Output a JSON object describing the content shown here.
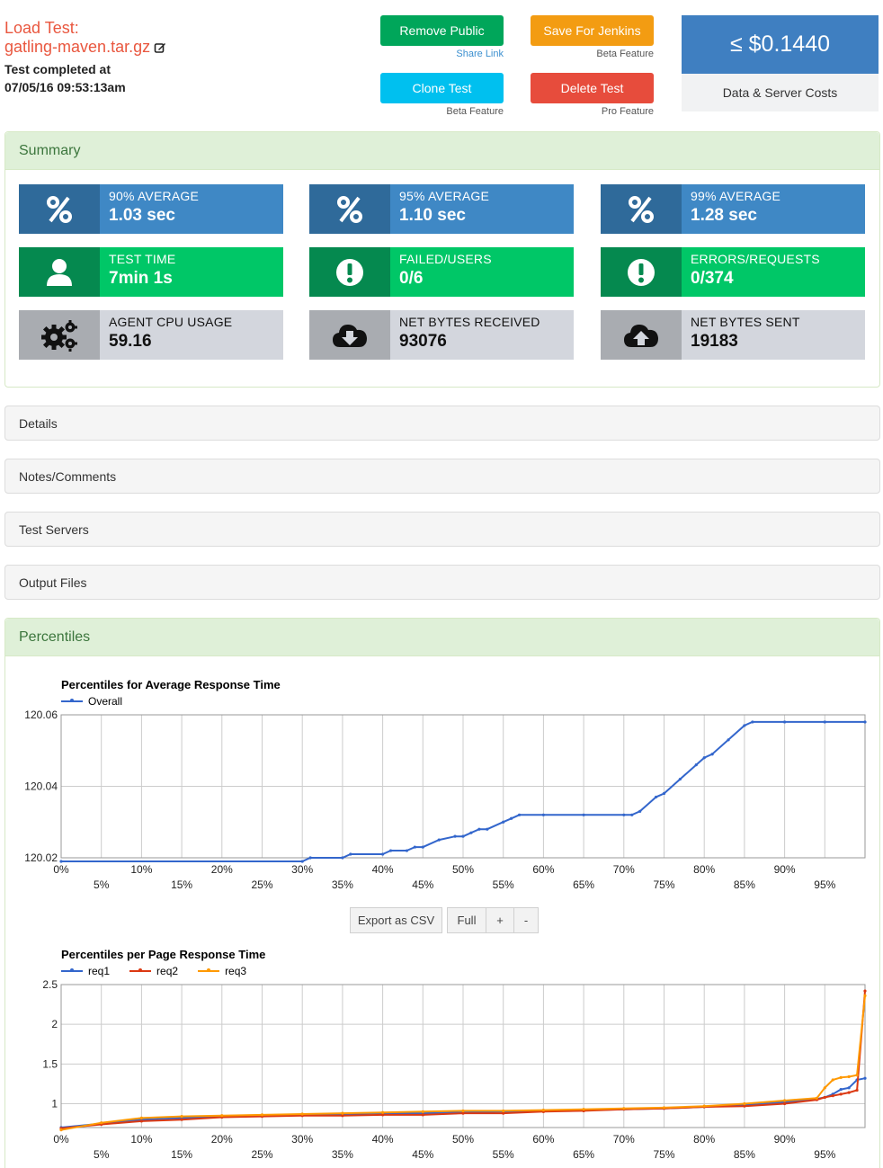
{
  "header": {
    "title_prefix": "Load Test:",
    "filename": "gatling-maven.tar.gz",
    "completed_label": "Test completed at",
    "completed_time": "07/05/16 09:53:13am"
  },
  "buttons": {
    "remove_public": "Remove Public",
    "share_link": "Share Link",
    "save_jenkins": "Save For Jenkins",
    "save_jenkins_note": "Beta Feature",
    "clone_test": "Clone Test",
    "clone_note": "Beta Feature",
    "delete_test": "Delete Test",
    "delete_note": "Pro Feature"
  },
  "cost": {
    "value": "≤ $0.1440",
    "label": "Data & Server Costs"
  },
  "summary": {
    "title": "Summary",
    "tiles": [
      {
        "label": "90% AVERAGE",
        "value": "1.03 sec",
        "icon": "percent-icon"
      },
      {
        "label": "95% AVERAGE",
        "value": "1.10 sec",
        "icon": "percent-icon"
      },
      {
        "label": "99% AVERAGE",
        "value": "1.28 sec",
        "icon": "percent-icon"
      },
      {
        "label": "TEST TIME",
        "value": "7min 1s",
        "icon": "user-icon"
      },
      {
        "label": "FAILED/USERS",
        "value": "0/6",
        "icon": "exclamation-icon"
      },
      {
        "label": "ERRORS/REQUESTS",
        "value": "0/374",
        "icon": "exclamation-icon"
      },
      {
        "label": "AGENT CPU USAGE",
        "value": "59.16",
        "icon": "gears-icon"
      },
      {
        "label": "NET BYTES RECEIVED",
        "value": "93076",
        "icon": "cloud-download-icon"
      },
      {
        "label": "NET BYTES SENT",
        "value": "19183",
        "icon": "cloud-upload-icon"
      }
    ]
  },
  "sections": [
    "Details",
    "Notes/Comments",
    "Test Servers",
    "Output Files"
  ],
  "percentiles": {
    "title": "Percentiles"
  },
  "controls": {
    "export_csv": "Export as CSV",
    "full": "Full",
    "plus": "+",
    "minus": "-"
  },
  "colors": {
    "blue": "#3366cc",
    "red": "#dc3912",
    "orange": "#ff9900",
    "accent_green": "#3c763d",
    "title_red": "#e9573f"
  },
  "chart_data": [
    {
      "type": "line",
      "title": "Percentiles for Average Response Time",
      "xlabel": "",
      "ylabel": "",
      "x_ticks": [
        "0%",
        "5%",
        "10%",
        "15%",
        "20%",
        "25%",
        "30%",
        "35%",
        "40%",
        "45%",
        "50%",
        "55%",
        "60%",
        "65%",
        "70%",
        "75%",
        "80%",
        "85%",
        "90%",
        "95%"
      ],
      "y_ticks": [
        "120.02",
        "120.04",
        "120.06"
      ],
      "xlim": [
        0,
        100
      ],
      "ylim": [
        120.02,
        120.06
      ],
      "grid": true,
      "legend": "top-left",
      "series": [
        {
          "name": "Overall",
          "color": "#3366cc",
          "x": [
            0,
            30,
            31,
            35,
            36,
            40,
            41,
            43,
            44,
            45,
            47,
            49,
            50,
            51,
            52,
            53,
            55,
            56,
            57,
            60,
            65,
            70,
            71,
            72,
            74,
            75,
            77,
            79,
            80,
            81,
            83,
            85,
            86,
            90,
            95,
            100
          ],
          "y": [
            120.019,
            120.019,
            120.02,
            120.02,
            120.021,
            120.021,
            120.022,
            120.022,
            120.023,
            120.023,
            120.025,
            120.026,
            120.026,
            120.027,
            120.028,
            120.028,
            120.03,
            120.031,
            120.032,
            120.032,
            120.032,
            120.032,
            120.032,
            120.033,
            120.037,
            120.038,
            120.042,
            120.046,
            120.048,
            120.049,
            120.053,
            120.057,
            120.058,
            120.058,
            120.058,
            120.058
          ]
        }
      ]
    },
    {
      "type": "line",
      "title": "Percentiles per Page Response Time",
      "xlabel": "",
      "ylabel": "",
      "x_ticks": [
        "0%",
        "5%",
        "10%",
        "15%",
        "20%",
        "25%",
        "30%",
        "35%",
        "40%",
        "45%",
        "50%",
        "55%",
        "60%",
        "65%",
        "70%",
        "75%",
        "80%",
        "85%",
        "90%",
        "95%"
      ],
      "y_ticks": [
        "1",
        "1.5",
        "2",
        "2.5"
      ],
      "xlim": [
        0,
        100
      ],
      "ylim": [
        0.7,
        2.5
      ],
      "grid": true,
      "legend": "top-left",
      "series": [
        {
          "name": "req1",
          "color": "#3366cc",
          "x": [
            0,
            5,
            10,
            15,
            20,
            25,
            30,
            35,
            40,
            45,
            50,
            55,
            60,
            65,
            70,
            75,
            80,
            85,
            90,
            94,
            95,
            96,
            97,
            98,
            99,
            100
          ],
          "y": [
            0.7,
            0.75,
            0.8,
            0.82,
            0.84,
            0.85,
            0.86,
            0.87,
            0.88,
            0.88,
            0.89,
            0.9,
            0.91,
            0.92,
            0.93,
            0.94,
            0.96,
            0.98,
            1.02,
            1.06,
            1.08,
            1.12,
            1.18,
            1.2,
            1.3,
            1.32
          ]
        },
        {
          "name": "req2",
          "color": "#dc3912",
          "x": [
            0,
            5,
            10,
            15,
            20,
            25,
            30,
            35,
            40,
            45,
            50,
            55,
            60,
            65,
            70,
            75,
            80,
            85,
            90,
            94,
            95,
            96,
            97,
            98,
            99,
            100
          ],
          "y": [
            0.69,
            0.74,
            0.78,
            0.8,
            0.83,
            0.84,
            0.85,
            0.85,
            0.86,
            0.86,
            0.88,
            0.88,
            0.9,
            0.91,
            0.93,
            0.94,
            0.96,
            0.97,
            1.0,
            1.05,
            1.08,
            1.1,
            1.12,
            1.14,
            1.17,
            2.42
          ]
        },
        {
          "name": "req3",
          "color": "#ff9900",
          "x": [
            0,
            5,
            10,
            15,
            20,
            25,
            30,
            35,
            40,
            45,
            50,
            55,
            60,
            65,
            70,
            75,
            80,
            85,
            90,
            94,
            95,
            96,
            97,
            98,
            99,
            100
          ],
          "y": [
            0.67,
            0.76,
            0.82,
            0.84,
            0.85,
            0.86,
            0.87,
            0.88,
            0.89,
            0.9,
            0.91,
            0.91,
            0.92,
            0.93,
            0.94,
            0.95,
            0.97,
            1.0,
            1.04,
            1.07,
            1.2,
            1.3,
            1.33,
            1.34,
            1.36,
            2.36
          ]
        }
      ]
    }
  ]
}
